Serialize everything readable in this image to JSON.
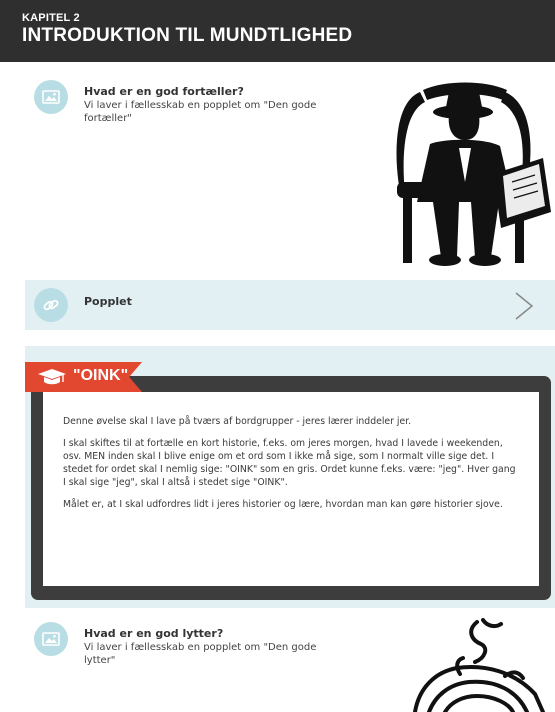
{
  "header": {
    "chapter": "KAPITEL 2",
    "title": "INTRODUKTION TIL MUNDTLIGHED"
  },
  "section1": {
    "icon": "image-icon",
    "title": "Hvad er en god fortæller?",
    "description": "Vi laver i fællesskab en popplet om \"Den gode fortæller\""
  },
  "link": {
    "icon": "link-icon",
    "label": "Popplet"
  },
  "oink": {
    "icon": "graduation-cap-icon",
    "title": "\"OINK\"",
    "paragraphs": [
      "Denne øvelse skal I lave på tværs af bordgrupper - jeres lærer inddeler jer.",
      "I skal skiftes til at fortælle en kort historie, f.eks. om jeres morgen, hvad I lavede i weekenden, osv. MEN inden skal I blive enige om et ord som I ikke må sige, som I normalt ville sige det. I stedet for ordet skal I nemlig sige: \"OINK\" som en gris. Ordet kunne f.eks. være: \"jeg\". Hver gang I skal sige \"jeg\", skal I altså i stedet sige \"OINK\".",
      "Målet er, at I skal udfordres lidt i jeres historier og lære, hvordan man kan gøre historier sjove."
    ]
  },
  "section2": {
    "icon": "image-icon",
    "title": "Hvad er en god lytter?",
    "description": "Vi laver i fællesskab en popplet om \"Den gode lytter\""
  },
  "colors": {
    "header_bg": "#2f2f2f",
    "accent_red": "#e2472f",
    "light_blue": "#e3f0f3",
    "icon_blue": "#b9dde4"
  }
}
